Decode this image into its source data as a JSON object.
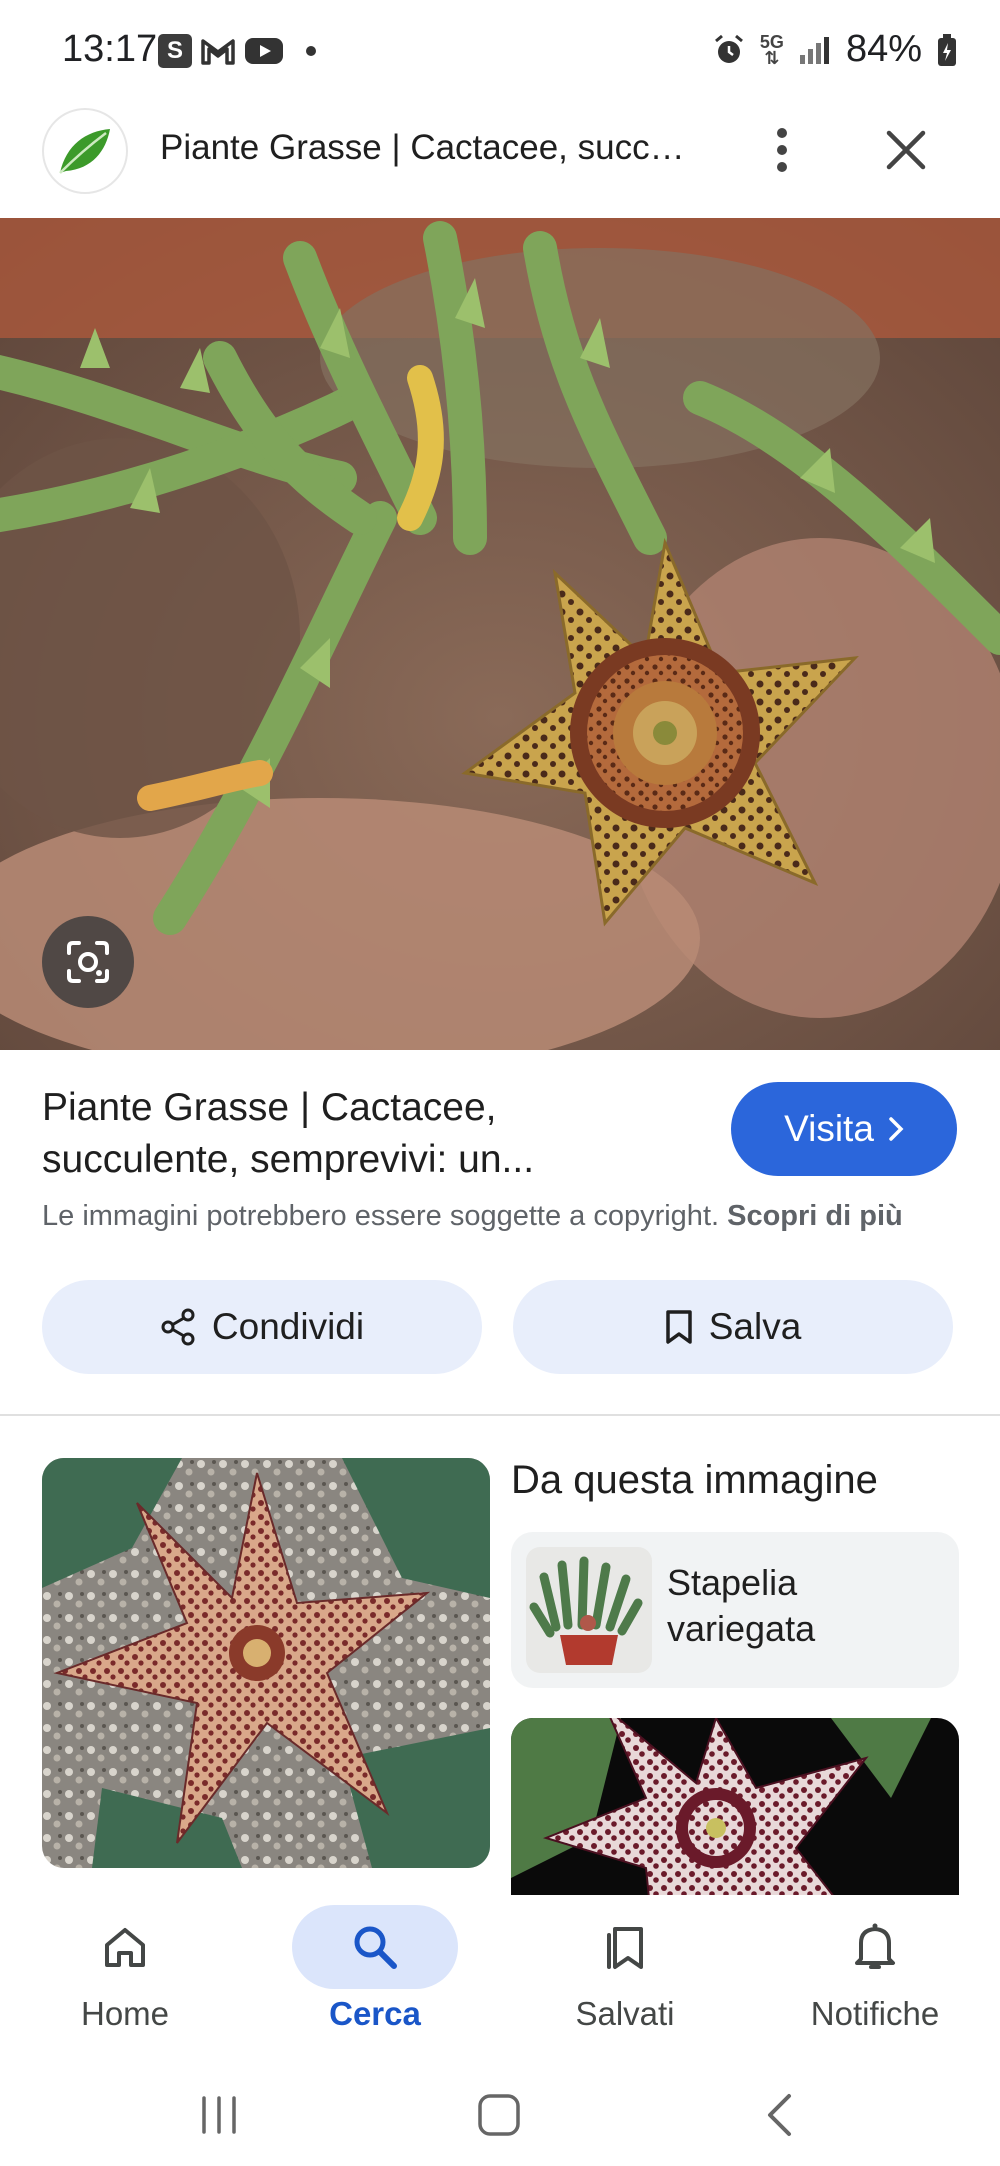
{
  "status_bar": {
    "time": "13:17",
    "left_icons": [
      "S",
      "gmail-icon",
      "youtube-icon"
    ],
    "network": "5G",
    "battery": "84%"
  },
  "header": {
    "title": "Piante Grasse | Cactacee, succulente, semprevivi: un..."
  },
  "result": {
    "title": "Piante Grasse | Cactacee, succulente, semprevivi: un...",
    "visit_label": "Visita",
    "copyright_text": "Le immagini potrebbero essere soggette a copyright.",
    "learn_more": "Scopri di più",
    "share_label": "Condividi",
    "save_label": "Salva"
  },
  "from_image": {
    "title": "Da questa immagine",
    "entity_name": "Stapelia variegata"
  },
  "bottom_nav": {
    "items": [
      {
        "label": "Home",
        "icon": "home-icon"
      },
      {
        "label": "Cerca",
        "icon": "search-icon",
        "active": true
      },
      {
        "label": "Salvati",
        "icon": "saved-icon"
      },
      {
        "label": "Notifiche",
        "icon": "bell-icon"
      }
    ]
  },
  "colors": {
    "accent": "#2b66db",
    "pill": "#e8eefb",
    "active_nav": "#dbe5fb"
  }
}
